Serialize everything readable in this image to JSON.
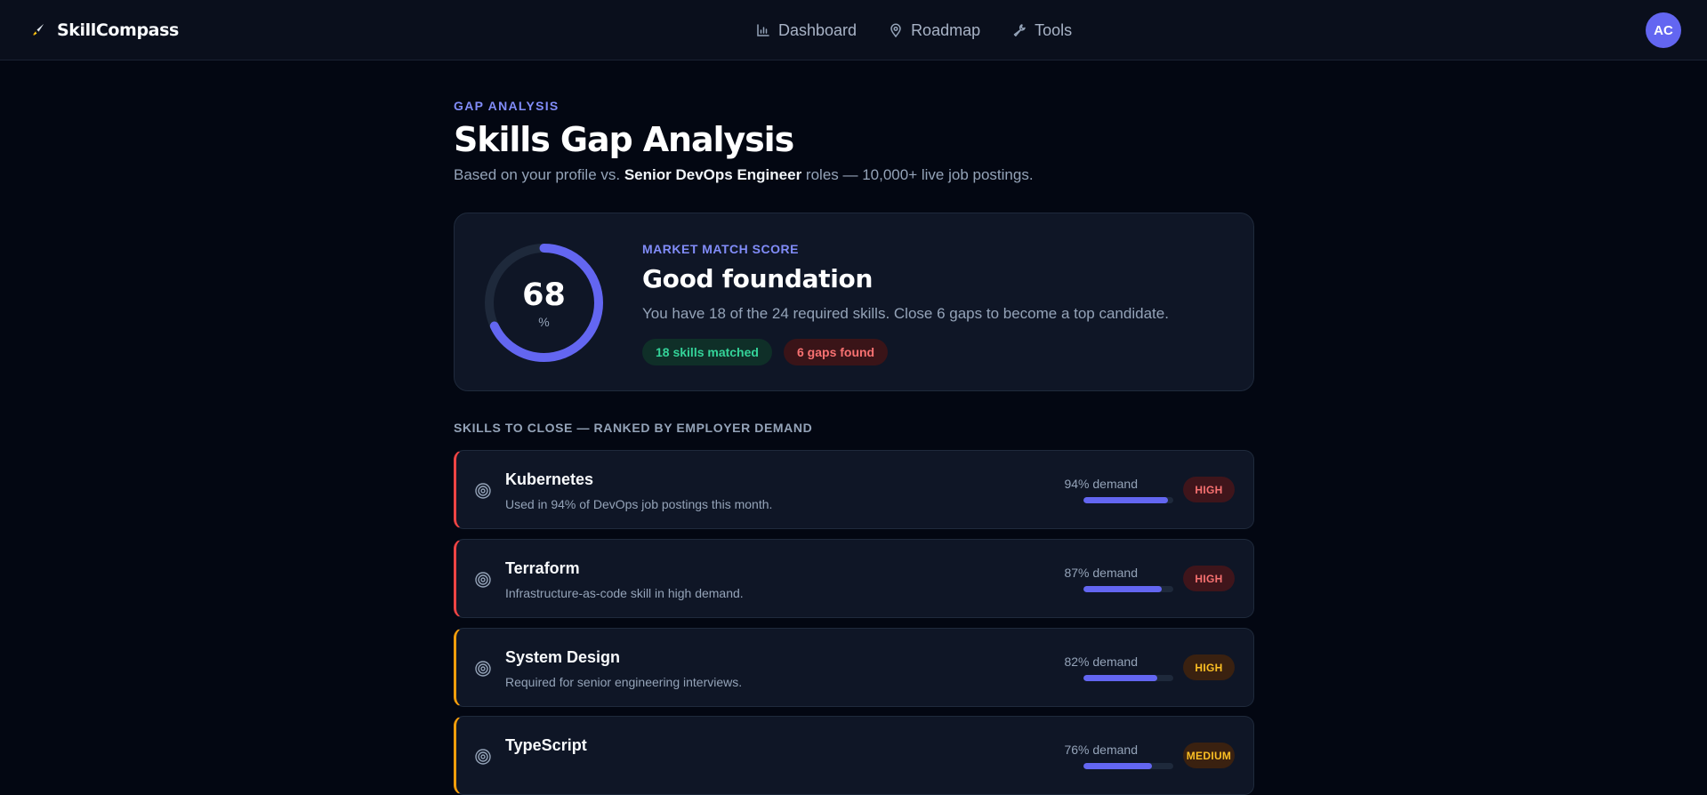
{
  "app": {
    "brand": "SkillCompass",
    "avatar_initials": "AC"
  },
  "nav": {
    "items": [
      {
        "label": "Dashboard",
        "icon": "bar-chart-icon"
      },
      {
        "label": "Roadmap",
        "icon": "map-pin-icon"
      },
      {
        "label": "Tools",
        "icon": "wrench-icon"
      }
    ]
  },
  "header": {
    "eyebrow": "GAP ANALYSIS",
    "title": "Skills Gap Analysis",
    "subtitle_prefix": "Based on your profile vs.",
    "subtitle_role": "Senior DevOps Engineer",
    "subtitle_suffix": "roles — 10,000+ live job postings."
  },
  "score": {
    "value": "68",
    "value_percent": 68,
    "unit": "%",
    "label": "MARKET MATCH SCORE",
    "title": "Good foundation",
    "description": "You have 18 of the 24 required skills. Close 6 gaps to become a top candidate.",
    "matched_pill": "18 skills matched",
    "gaps_pill": "6 gaps found"
  },
  "section": {
    "heading": "SKILLS TO CLOSE — RANKED BY EMPLOYER DEMAND"
  },
  "skills": [
    {
      "name": "Kubernetes",
      "description": "Used in 94% of DevOps job postings this month.",
      "demand_label": "94% demand",
      "demand": 94,
      "priority": "HIGH"
    },
    {
      "name": "Terraform",
      "description": "Infrastructure-as-code skill in high demand.",
      "demand_label": "87% demand",
      "demand": 87,
      "priority": "HIGH"
    },
    {
      "name": "System Design",
      "description": "Required for senior engineering interviews.",
      "demand_label": "82% demand",
      "demand": 82,
      "priority": "HIGH"
    },
    {
      "name": "TypeScript",
      "description": "",
      "demand_label": "76% demand",
      "demand": 76,
      "priority": "MEDIUM"
    }
  ],
  "colors": {
    "accent": "#6366f1",
    "accent_text": "#818cf8",
    "high": "#ef4444",
    "medium": "#f59e0b",
    "success": "#34d399"
  }
}
